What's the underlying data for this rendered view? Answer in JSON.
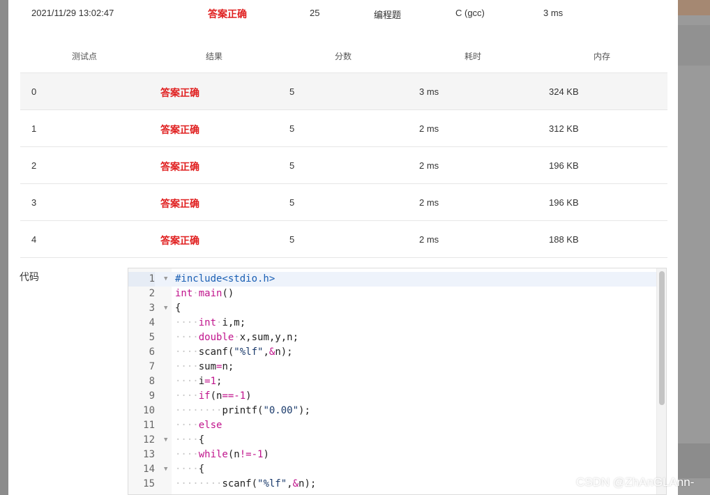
{
  "summary": {
    "submit_time": "2021/11/29 13:02:47",
    "result": "答案正确",
    "score": "25",
    "problem_type": "编程题",
    "language": "C (gcc)",
    "duration": "3 ms"
  },
  "test_table": {
    "headers": [
      "测试点",
      "结果",
      "分数",
      "耗时",
      "内存"
    ],
    "rows": [
      {
        "id": "0",
        "result": "答案正确",
        "score": "5",
        "time": "3 ms",
        "memory": "324 KB"
      },
      {
        "id": "1",
        "result": "答案正确",
        "score": "5",
        "time": "2 ms",
        "memory": "312 KB"
      },
      {
        "id": "2",
        "result": "答案正确",
        "score": "5",
        "time": "2 ms",
        "memory": "196 KB"
      },
      {
        "id": "3",
        "result": "答案正确",
        "score": "5",
        "time": "2 ms",
        "memory": "196 KB"
      },
      {
        "id": "4",
        "result": "答案正确",
        "score": "5",
        "time": "2 ms",
        "memory": "188 KB"
      }
    ]
  },
  "code_section": {
    "label": "代码",
    "lines": [
      {
        "n": "1",
        "text": "#include<stdio.h>"
      },
      {
        "n": "2",
        "text": "int main()"
      },
      {
        "n": "3",
        "text": "{"
      },
      {
        "n": "4",
        "text": "    int i,m;"
      },
      {
        "n": "5",
        "text": "    double x,sum,y,n;"
      },
      {
        "n": "6",
        "text": "    scanf(\"%lf\",&n);"
      },
      {
        "n": "7",
        "text": "    sum=n;"
      },
      {
        "n": "8",
        "text": "    i=1;"
      },
      {
        "n": "9",
        "text": "    if(n==-1)"
      },
      {
        "n": "10",
        "text": "        printf(\"0.00\");"
      },
      {
        "n": "11",
        "text": "    else"
      },
      {
        "n": "12",
        "text": "    {"
      },
      {
        "n": "13",
        "text": "    while(n!=-1)"
      },
      {
        "n": "14",
        "text": "    {"
      },
      {
        "n": "15",
        "text": "        scanf(\"%lf\",&n);"
      }
    ]
  },
  "watermark": "CSDN @ZhAnGLAnn-",
  "colors": {
    "accepted": "#e02020",
    "keyword": "#c0148c",
    "preprocessor": "#1a5fb4"
  }
}
